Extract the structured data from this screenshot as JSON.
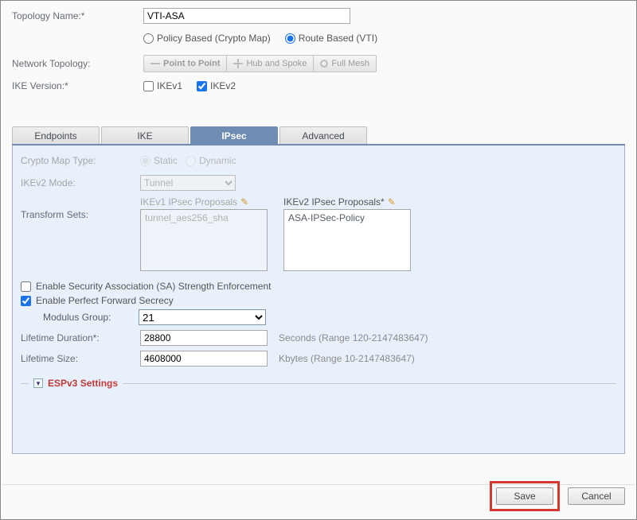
{
  "labels": {
    "topology_name": "Topology Name:*",
    "network_topology": "Network Topology:",
    "ike_version": "IKE Version:*"
  },
  "topology_name_value": "VTI-ASA",
  "routing": {
    "policy": "Policy Based (Crypto Map)",
    "route": "Route Based (VTI)",
    "selected": "route"
  },
  "net_topology": {
    "p2p": "Point to Point",
    "hub": "Hub and Spoke",
    "mesh": "Full Mesh",
    "selected": "p2p"
  },
  "ike": {
    "v1": "IKEv1",
    "v2": "IKEv2",
    "v1_checked": false,
    "v2_checked": true
  },
  "tabs": {
    "endpoints": "Endpoints",
    "ike": "IKE",
    "ipsec": "IPsec",
    "advanced": "Advanced",
    "active": "ipsec"
  },
  "ipsec": {
    "crypto_map_label": "Crypto Map Type:",
    "crypto_static": "Static",
    "crypto_dynamic": "Dynamic",
    "ikev2_mode_label": "IKEv2 Mode:",
    "ikev2_mode_value": "Tunnel",
    "transform_sets_label": "Transform Sets:",
    "ts_v1_title": "IKEv1 IPsec Proposals",
    "ts_v1_value": "tunnel_aes256_sha",
    "ts_v2_title": "IKEv2 IPsec Proposals*",
    "ts_v2_value": "ASA-IPSec-Policy",
    "sa_enforce_label": "Enable Security Association (SA) Strength Enforcement",
    "sa_enforce_checked": false,
    "pfs_label": "Enable Perfect Forward Secrecy",
    "pfs_checked": true,
    "modulus_label": "Modulus Group:",
    "modulus_value": "21",
    "lifetime_dur_label": "Lifetime Duration*:",
    "lifetime_dur_value": "28800",
    "lifetime_dur_hint": "Seconds (Range 120-2147483647)",
    "lifetime_size_label": "Lifetime Size:",
    "lifetime_size_value": "4608000",
    "lifetime_size_hint": "Kbytes (Range 10-2147483647)",
    "espv3_title": "ESPv3 Settings"
  },
  "footer": {
    "save": "Save",
    "cancel": "Cancel"
  }
}
